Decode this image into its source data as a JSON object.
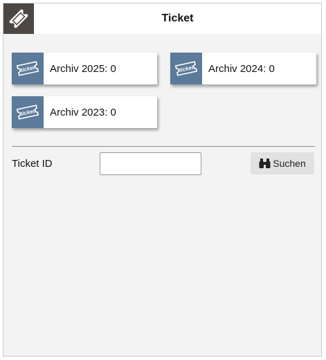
{
  "header": {
    "title": "Ticket",
    "logo_icon": "ticket-icon"
  },
  "archives": [
    {
      "label": "Archiv 2025: 0",
      "icon": "ticket-icon"
    },
    {
      "label": "Archiv 2024: 0",
      "icon": "ticket-icon"
    },
    {
      "label": "Archiv 2023: 0",
      "icon": "ticket-icon"
    }
  ],
  "ticket_icon_text": "ticket",
  "search": {
    "label": "Ticket ID",
    "value": "",
    "button_label": "Suchen",
    "button_icon": "binoculars-icon"
  },
  "colors": {
    "logo_bg": "#4d4744",
    "tile_icon_bg": "#5c7a99",
    "panel_bg": "#f3f3f3",
    "button_bg": "#e1e1e1"
  }
}
